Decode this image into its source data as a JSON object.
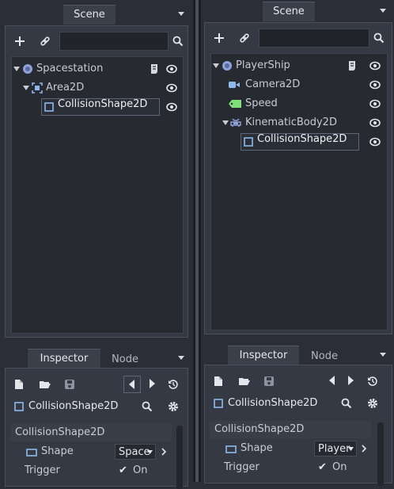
{
  "left": {
    "scene_tab": "Scene",
    "tree": [
      {
        "label": "Spacestation",
        "icon": "node2d-icon"
      },
      {
        "label": "Area2D",
        "icon": "area2d-icon"
      },
      {
        "label": "CollisionShape2D",
        "icon": "collisionshape2d-icon",
        "selected": true
      }
    ],
    "inspector_tab": "Inspector",
    "node_tab": "Node",
    "inspected_node": "CollisionShape2D",
    "category": "CollisionShape2D",
    "props": {
      "shape_label": "Shape",
      "shape_value": "Space",
      "trigger_label": "Trigger",
      "trigger_value": "On",
      "trigger_check": "✔"
    }
  },
  "right": {
    "scene_tab": "Scene",
    "tree": [
      {
        "label": "PlayerShip",
        "icon": "node2d-icon"
      },
      {
        "label": "Camera2D",
        "icon": "camera2d-icon"
      },
      {
        "label": "Speed",
        "icon": "label-tag-icon"
      },
      {
        "label": "KinematicBody2D",
        "icon": "kinematicbody2d-icon"
      },
      {
        "label": "CollisionShape2D",
        "icon": "collisionshape2d-icon",
        "selected": true
      }
    ],
    "inspector_tab": "Inspector",
    "node_tab": "Node",
    "inspected_node": "CollisionShape2D",
    "category": "CollisionShape2D",
    "props": {
      "shape_label": "Shape",
      "shape_value": "Player",
      "trigger_label": "Trigger",
      "trigger_value": "On",
      "trigger_check": "✔"
    }
  },
  "colors": {
    "background": "#2b2e36",
    "tree_bg": "#272a31",
    "selection_border": "#5d6576",
    "text": "#c8ccd2",
    "collision_icon": "#8fb9ec",
    "camera_icon": "#8fb9ec",
    "label_icon": "#7fe07a",
    "area_icon": "#8fb9ec"
  }
}
